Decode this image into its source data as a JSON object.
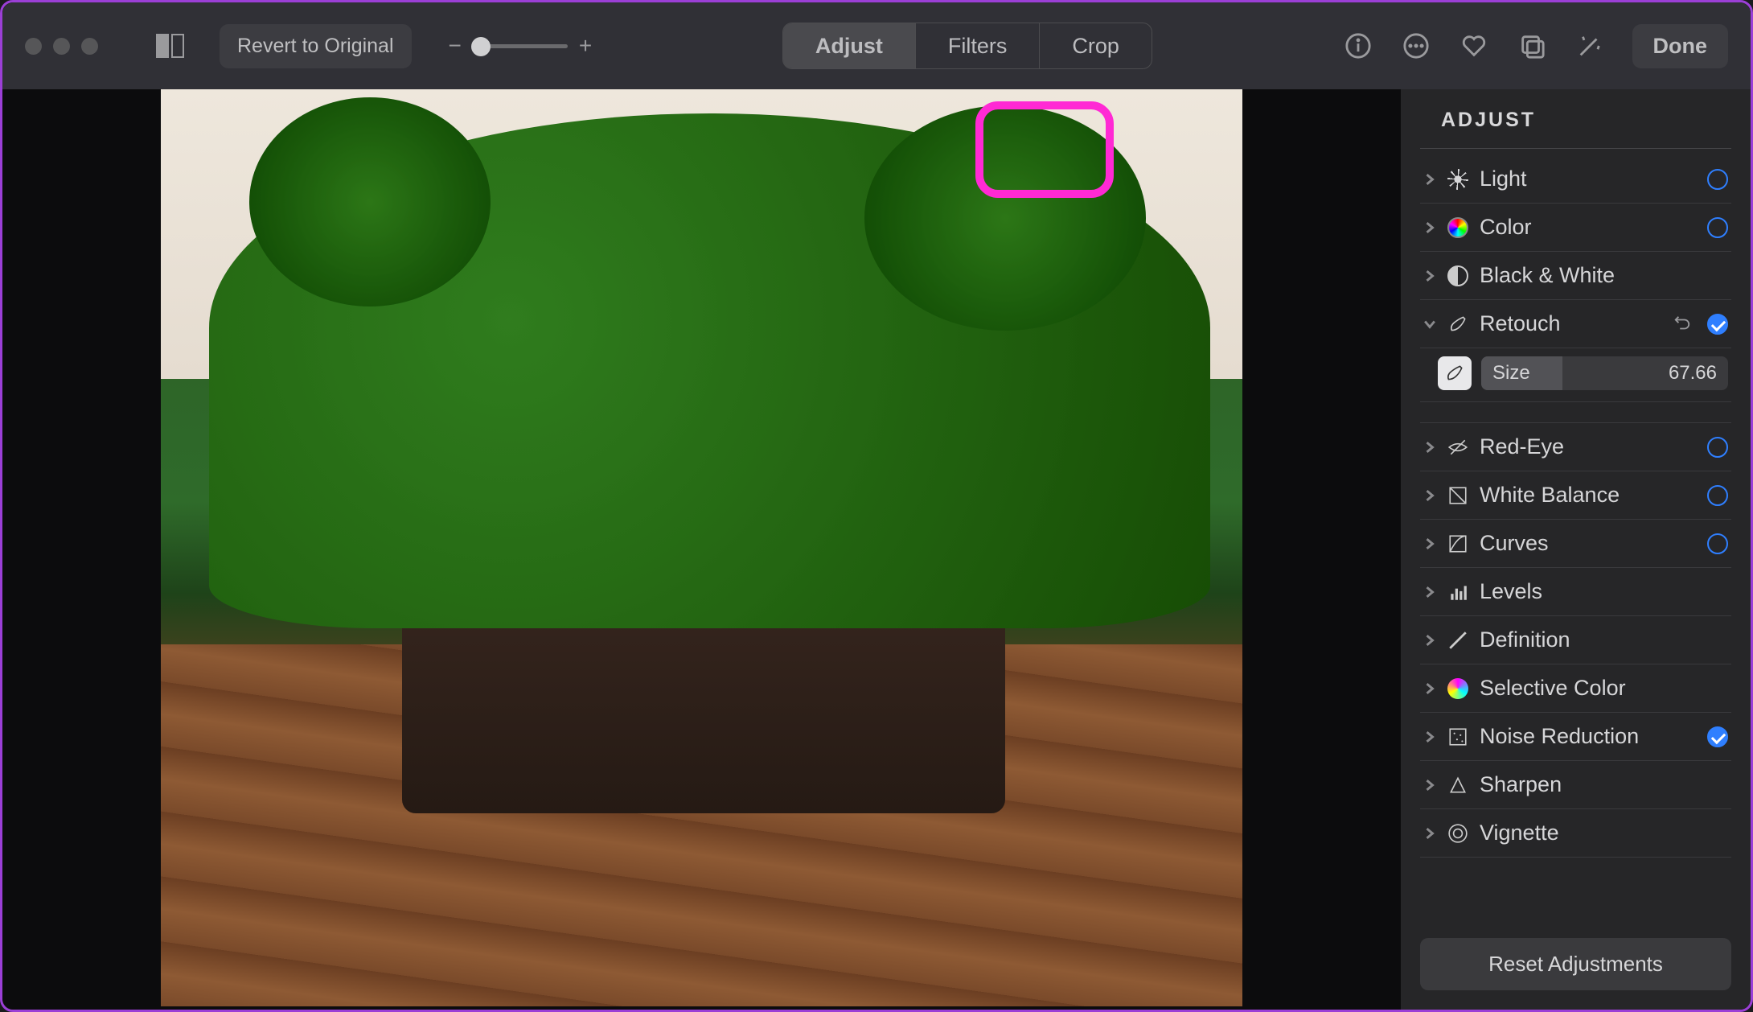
{
  "toolbar": {
    "revert_label": "Revert to Original",
    "tabs": {
      "adjust": "Adjust",
      "filters": "Filters",
      "crop": "Crop"
    },
    "done_label": "Done"
  },
  "sidebar": {
    "title": "ADJUST",
    "reset_label": "Reset Adjustments",
    "retouch": {
      "size_label": "Size",
      "size_value": "67.66"
    },
    "items": [
      {
        "id": "light",
        "label": "Light",
        "badge": "ring"
      },
      {
        "id": "color",
        "label": "Color",
        "badge": "ring"
      },
      {
        "id": "bw",
        "label": "Black & White",
        "badge": "none"
      },
      {
        "id": "retouch",
        "label": "Retouch",
        "badge": "check",
        "expanded": true,
        "undo": true
      },
      {
        "id": "redeye",
        "label": "Red-Eye",
        "badge": "ring"
      },
      {
        "id": "wb",
        "label": "White Balance",
        "badge": "ring"
      },
      {
        "id": "curves",
        "label": "Curves",
        "badge": "ring"
      },
      {
        "id": "levels",
        "label": "Levels",
        "badge": "none"
      },
      {
        "id": "definition",
        "label": "Definition",
        "badge": "none"
      },
      {
        "id": "selcolor",
        "label": "Selective Color",
        "badge": "none"
      },
      {
        "id": "noise",
        "label": "Noise Reduction",
        "badge": "check"
      },
      {
        "id": "sharpen",
        "label": "Sharpen",
        "badge": "none"
      },
      {
        "id": "vignette",
        "label": "Vignette",
        "badge": "none"
      }
    ]
  }
}
